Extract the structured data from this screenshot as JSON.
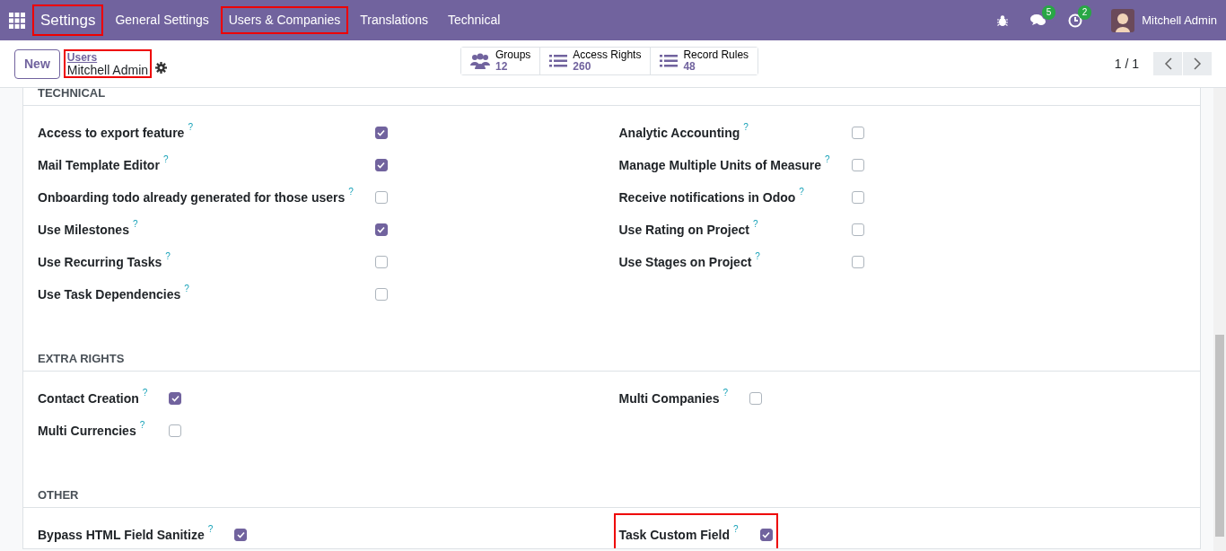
{
  "navbar": {
    "app": {
      "label": "Settings",
      "highlighted": true
    },
    "menu": [
      {
        "label": "General Settings",
        "highlighted": false
      },
      {
        "label": "Users & Companies",
        "highlighted": true
      },
      {
        "label": "Translations",
        "highlighted": false
      },
      {
        "label": "Technical",
        "highlighted": false
      }
    ],
    "messages_count": "5",
    "activities_count": "2",
    "user": "Mitchell Admin"
  },
  "control_panel": {
    "new_button": "New",
    "breadcrumb": {
      "parent": "Users",
      "current": "Mitchell Admin",
      "highlighted": true
    },
    "stat_buttons": [
      {
        "kind": "groups",
        "label": "Groups",
        "value": "12"
      },
      {
        "kind": "list",
        "label": "Access Rights",
        "value": "260"
      },
      {
        "kind": "list",
        "label": "Record Rules",
        "value": "48"
      }
    ],
    "pager": "1 / 1"
  },
  "sections": [
    {
      "title": "TECHNICAL",
      "left": [
        {
          "label": "Access to export feature",
          "checked": true,
          "highlighted": false
        },
        {
          "label": "Mail Template Editor",
          "checked": true,
          "highlighted": false
        },
        {
          "label": "Onboarding todo already generated for those users",
          "checked": false,
          "highlighted": false
        },
        {
          "label": "Use Milestones",
          "checked": true,
          "highlighted": false
        },
        {
          "label": "Use Recurring Tasks",
          "checked": false,
          "highlighted": false
        },
        {
          "label": "Use Task Dependencies",
          "checked": false,
          "highlighted": false
        }
      ],
      "right": [
        {
          "label": "Analytic Accounting",
          "checked": false,
          "highlighted": false
        },
        {
          "label": "Manage Multiple Units of Measure",
          "checked": false,
          "highlighted": false
        },
        {
          "label": "Receive notifications in Odoo",
          "checked": false,
          "highlighted": false
        },
        {
          "label": "Use Rating on Project",
          "checked": false,
          "highlighted": false
        },
        {
          "label": "Use Stages on Project",
          "checked": false,
          "highlighted": false
        }
      ]
    },
    {
      "title": "EXTRA RIGHTS",
      "left": [
        {
          "label": "Contact Creation",
          "checked": true,
          "highlighted": false
        },
        {
          "label": "Multi Currencies",
          "checked": false,
          "highlighted": false
        }
      ],
      "right": [
        {
          "label": "Multi Companies",
          "checked": false,
          "highlighted": false
        }
      ]
    },
    {
      "title": "OTHER",
      "left": [
        {
          "label": "Bypass HTML Field Sanitize",
          "checked": true,
          "highlighted": false
        }
      ],
      "right": [
        {
          "label": "Task Custom Field",
          "checked": true,
          "highlighted": true
        }
      ]
    }
  ],
  "help_mark": "?"
}
